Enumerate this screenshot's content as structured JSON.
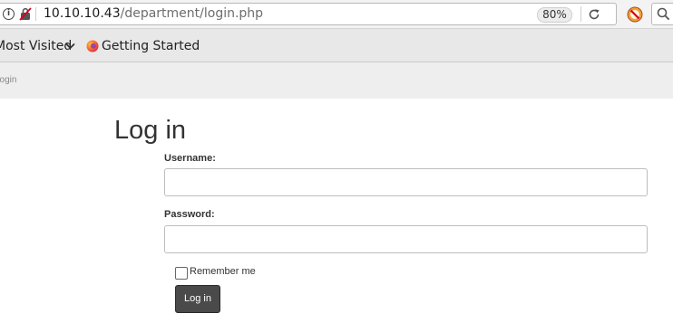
{
  "browser": {
    "url_host": "10.10.10.43",
    "url_path": "/department/login.php",
    "zoom": "80%",
    "icons": {
      "info": "info-icon",
      "insecure": "insecure-connection-icon",
      "reload": "reload-icon",
      "extension": "extension-icon",
      "search": "search-icon"
    }
  },
  "bookmarks": {
    "most_visited": "Most Visited",
    "getting_started": "Getting Started"
  },
  "page": {
    "breadcrumb": "Login",
    "title": "Log in",
    "username_label": "Username:",
    "username_value": "",
    "password_label": "Password:",
    "password_value": "",
    "remember_label": "Remember me",
    "remember_checked": false,
    "submit_label": "Log in"
  },
  "colors": {
    "button_bg": "#4a4a4a",
    "page_header_bg": "#eeeeee",
    "toolbar_bg": "#e8e8e8"
  }
}
